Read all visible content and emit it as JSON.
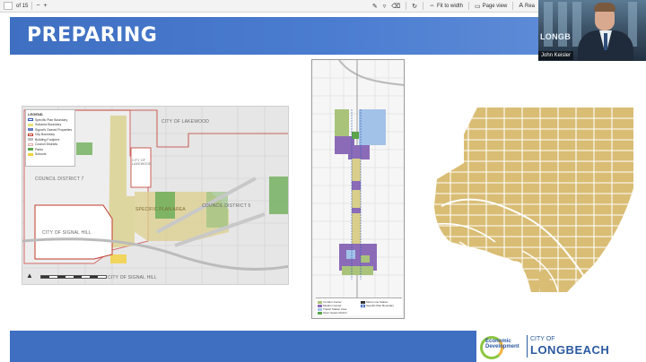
{
  "toolbar": {
    "page_indicator": "of 15",
    "fit_to_width_label": "Fit to width",
    "page_view_label": "Page view",
    "read_aloud_label": "Rea",
    "icons": [
      "zoom-out-icon",
      "zoom-in-icon",
      "rotate-icon",
      "draw-icon",
      "highlight-icon",
      "erase-icon",
      "fit-width-icon",
      "page-view-icon",
      "read-aloud-icon"
    ]
  },
  "slide": {
    "title": "PREPARING",
    "colors": {
      "title_bar": "#3f6fc1",
      "footer_bar": "#3f6fc1",
      "map3_fill": "#d9bd74",
      "map3_lines": "#ffffff"
    }
  },
  "map1": {
    "legend_title": "LEGEND",
    "legend_items": [
      {
        "label": "Specific Plan Boundary",
        "color": "#2f5db8"
      },
      {
        "label": "Subarea Boundary",
        "color": "#e9e27a"
      },
      {
        "label": "Signal's Owned Properties",
        "color": "#6a7cc8"
      },
      {
        "label": "City Boundary",
        "color": "#c0392b"
      },
      {
        "label": "Building Footprint",
        "color": "#bdbdbd"
      },
      {
        "label": "Council Districts",
        "color": "#e7a9a9"
      },
      {
        "label": "Parks",
        "color": "#5aa54a"
      },
      {
        "label": "Schools",
        "color": "#f4d13b"
      }
    ],
    "labels": {
      "lakewood": "CITY OF LAKEWOOD",
      "council7": "COUNCIL DISTRICT 7",
      "council5": "COUNCIL DISTRICT 5",
      "signal_hill_inner": "CITY OF SIGNAL HILL",
      "signal_hill_bottom": "CITY OF SIGNAL HILL",
      "lakewood_inner": "CITY OF LAKEWOOD",
      "specific_plan": "SPECIFIC PLAN AREA"
    }
  },
  "map2": {
    "legend_items": [
      {
        "label": "Corridor Center",
        "color": "#a9c47a"
      },
      {
        "label": "Medium Center",
        "color": "#8b6bb8"
      },
      {
        "label": "Transit Station Area",
        "color": "#a3c2e8"
      },
      {
        "label": "Open Space District",
        "color": "#5aa54a"
      },
      {
        "label": "Metro Line Station",
        "color": "#333333"
      },
      {
        "label": "Specific Plan Boundary",
        "color": "#2f5db8"
      }
    ]
  },
  "webcam": {
    "sign_text": "LONGB",
    "person_name": "John Keisler"
  },
  "logos": {
    "econ_text": "Economic Development",
    "city_of": "CITY OF",
    "long_beach": "LONGBEACH"
  }
}
